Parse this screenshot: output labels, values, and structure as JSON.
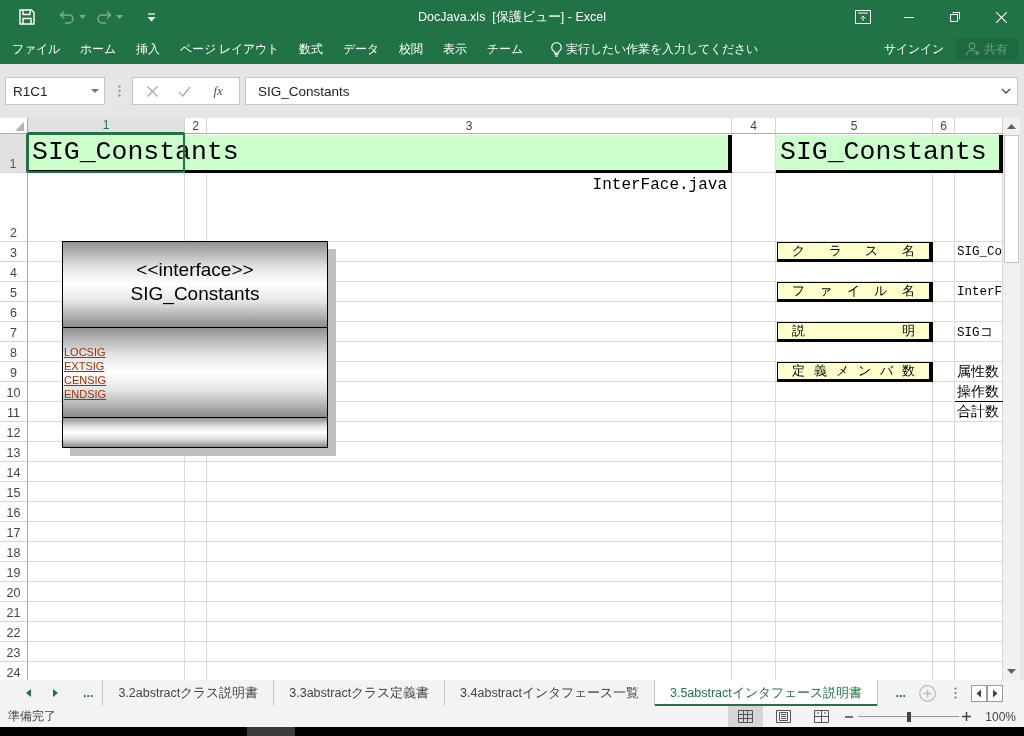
{
  "window": {
    "title": "DocJava.xls  [保護ビュー] - Excel"
  },
  "quick_access": [
    {
      "kind": "save",
      "disabled": false
    },
    {
      "kind": "undo",
      "disabled": true
    },
    {
      "kind": "redo",
      "disabled": true
    },
    {
      "kind": "customize",
      "disabled": false
    }
  ],
  "ribbon_tabs": [
    "ファイル",
    "ホーム",
    "挿入",
    "ページ レイアウト",
    "数式",
    "データ",
    "校閲",
    "表示",
    "チーム"
  ],
  "tell_me": {
    "placeholder": "実行したい作業を入力してください"
  },
  "account": {
    "sign_in": "サインイン",
    "share": {
      "label": "共有",
      "disabled": true
    }
  },
  "formula_bar": {
    "name_box": "R1C1",
    "function_label": "fx",
    "formula": "SIG_Constants"
  },
  "sheet": {
    "columns": [
      {
        "label": "1",
        "selected": true
      },
      {
        "label": "2",
        "selected": false
      },
      {
        "label": "3",
        "selected": false
      },
      {
        "label": "4",
        "selected": false
      },
      {
        "label": "5",
        "selected": false
      },
      {
        "label": "6",
        "selected": false
      }
    ],
    "rows": [
      {
        "label": "1",
        "selected": true
      },
      {
        "label": "2",
        "selected": false
      },
      {
        "label": "3",
        "selected": false
      },
      {
        "label": "4",
        "selected": false
      },
      {
        "label": "5",
        "selected": false
      },
      {
        "label": "6",
        "selected": false
      },
      {
        "label": "7",
        "selected": false
      },
      {
        "label": "8",
        "selected": false
      },
      {
        "label": "9",
        "selected": false
      },
      {
        "label": "10",
        "selected": false
      },
      {
        "label": "11",
        "selected": false
      },
      {
        "label": "12",
        "selected": false
      },
      {
        "label": "13",
        "selected": false
      },
      {
        "label": "14",
        "selected": false
      },
      {
        "label": "15",
        "selected": false
      },
      {
        "label": "16",
        "selected": false
      },
      {
        "label": "17",
        "selected": false
      },
      {
        "label": "18",
        "selected": false
      },
      {
        "label": "19",
        "selected": false
      },
      {
        "label": "20",
        "selected": false
      },
      {
        "label": "21",
        "selected": false
      },
      {
        "label": "22",
        "selected": false
      },
      {
        "label": "23",
        "selected": false
      },
      {
        "label": "24",
        "selected": false
      }
    ],
    "title_cells": [
      "SIG_Constants",
      "SIG_Constants"
    ],
    "file_name": "InterFace.java",
    "class_diagram": {
      "stereotype": "<<interface>>",
      "name": "SIG_Constants",
      "attributes": [
        "LOCSIG",
        "EXTSIG",
        "CENSIG",
        "ENDSIG"
      ]
    },
    "info": [
      {
        "label": "ク ラ ス 名",
        "values": [
          "SIG_Co"
        ]
      },
      {
        "label": "フ ァ イ ル 名",
        "values": [
          "InterF"
        ]
      },
      {
        "label": "説 明",
        "values": [
          "SIGコ"
        ]
      },
      {
        "label": "定 義 メ ン バ 数",
        "values": [
          "属性数",
          "操作数",
          "合計数"
        ]
      }
    ]
  },
  "sheet_tabs": {
    "more_before": "...",
    "tabs": [
      {
        "label": "3.2abstractクラス説明書",
        "selected": false
      },
      {
        "label": "3.3abstractクラス定義書",
        "selected": false
      },
      {
        "label": "3.4abstractインタフェース一覧",
        "selected": false
      },
      {
        "label": "3.5abstractインタフェース説明書",
        "selected": true
      }
    ],
    "more_after": "..."
  },
  "status_bar": {
    "status": "準備完了",
    "views": [
      {
        "kind": "normal",
        "selected": true
      },
      {
        "kind": "page_layout",
        "selected": false
      },
      {
        "kind": "page_break",
        "selected": false
      }
    ],
    "zoom": {
      "level": 0.5,
      "reading": "100%"
    }
  }
}
